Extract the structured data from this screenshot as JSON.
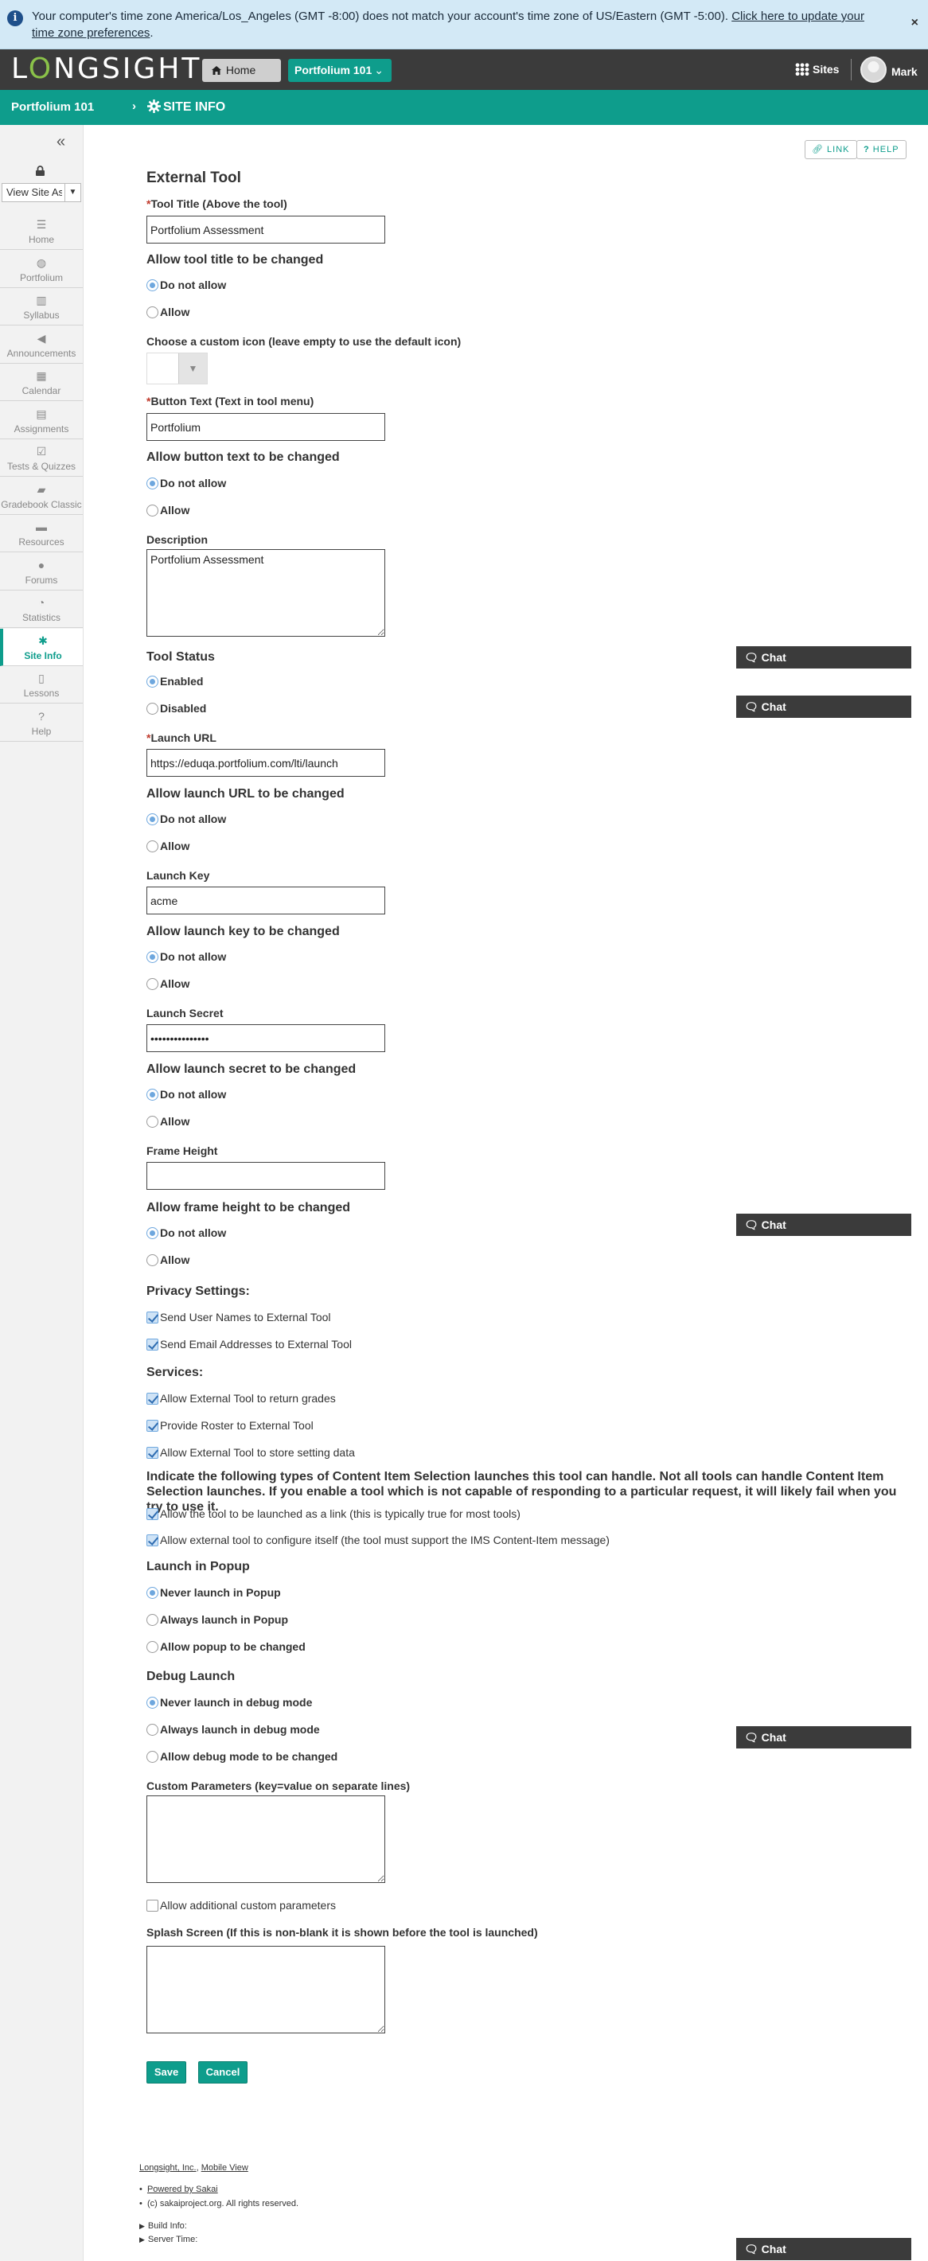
{
  "banner": {
    "message": "Your computer's time zone America/Los_Angeles (GMT -8:00) does not match your account's time zone of US/Eastern (GMT -5:00). ",
    "link": "Click here to update your time zone preferences",
    "period": ".",
    "close": "×"
  },
  "header": {
    "logo_pre": "L",
    "logo_leaf": "O",
    "logo_post": "NGSIGHT",
    "home": "Home",
    "site": "Portfolium 101",
    "sites": "Sites",
    "user": "Mark"
  },
  "breadcrumb": {
    "site": "Portfolium 101",
    "sep": "›",
    "page": "SITE INFO"
  },
  "sidebar": {
    "view_as": "View Site As",
    "items": [
      {
        "label": "Home",
        "icon": "home-icon",
        "glyph": "☰"
      },
      {
        "label": "Portfolium",
        "icon": "globe-icon",
        "glyph": "◍"
      },
      {
        "label": "Syllabus",
        "icon": "map-icon",
        "glyph": "▥"
      },
      {
        "label": "Announcements",
        "icon": "bullhorn-icon",
        "glyph": "◀"
      },
      {
        "label": "Calendar",
        "icon": "calendar-icon",
        "glyph": "▦"
      },
      {
        "label": "Assignments",
        "icon": "file-icon",
        "glyph": "▤"
      },
      {
        "label": "Tests & Quizzes",
        "icon": "checkbox-icon",
        "glyph": "☑"
      },
      {
        "label": "Gradebook Classic",
        "icon": "book-icon",
        "glyph": "▰"
      },
      {
        "label": "Resources",
        "icon": "folder-icon",
        "glyph": "▬"
      },
      {
        "label": "Forums",
        "icon": "comments-icon",
        "glyph": "●"
      },
      {
        "label": "Statistics",
        "icon": "pie-chart-icon",
        "glyph": "◔"
      },
      {
        "label": "Site Info",
        "icon": "gear-icon",
        "glyph": "✱"
      },
      {
        "label": "Lessons",
        "icon": "open-book-icon",
        "glyph": "▯"
      },
      {
        "label": "Help",
        "icon": "question-icon",
        "glyph": "?"
      }
    ]
  },
  "links": {
    "link": "LINK",
    "help": "HELP"
  },
  "form": {
    "title": "External Tool",
    "tool_title_label": "Tool Title (Above the tool)",
    "tool_title_value": "Portfolium Assessment",
    "allow_title_heading": "Allow tool title to be changed",
    "do_not_allow": "Do not allow",
    "allow": "Allow",
    "custom_icon_label": "Choose a custom icon (leave empty to use the default icon)",
    "button_text_label": "Button Text (Text in tool menu)",
    "button_text_value": "Portfolium",
    "allow_button_heading": "Allow button text to be changed",
    "description_label": "Description",
    "description_value": "Portfolium Assessment",
    "status_heading": "Tool Status",
    "enabled": "Enabled",
    "disabled": "Disabled",
    "launch_url_label": "Launch URL",
    "launch_url_value": "https://eduqa.portfolium.com/lti/launch",
    "allow_url_heading": "Allow launch URL to be changed",
    "launch_key_label": "Launch Key",
    "launch_key_value": "acme",
    "allow_key_heading": "Allow launch key to be changed",
    "launch_secret_label": "Launch Secret",
    "launch_secret_value": "•••••••••••••••",
    "allow_secret_heading": "Allow launch secret to be changed",
    "frame_height_label": "Frame Height",
    "frame_height_value": "",
    "allow_frame_heading": "Allow frame height to be changed",
    "privacy_heading": "Privacy Settings:",
    "send_names": "Send User Names to External Tool",
    "send_emails": "Send Email Addresses to External Tool",
    "services_heading": "Services:",
    "return_grades": "Allow External Tool to return grades",
    "provide_roster": "Provide Roster to External Tool",
    "store_settings": "Allow External Tool to store setting data",
    "content_item_heading": "Indicate the following types of Content Item Selection launches this tool can handle. Not all tools can handle Content Item Selection launches. If you enable a tool which is not capable of responding to a particular request, it will likely fail when you try to use it.",
    "launch_as_link": "Allow the tool to be launched as a link (this is typically true for most tools)",
    "configure_itself": "Allow external tool to configure itself (the tool must support the IMS Content-Item message)",
    "popup_heading": "Launch in Popup",
    "never_popup": "Never launch in Popup",
    "always_popup": "Always launch in Popup",
    "allow_popup_change": "Allow popup to be changed",
    "debug_heading": "Debug Launch",
    "never_debug": "Never launch in debug mode",
    "always_debug": "Always launch in debug mode",
    "allow_debug_change": "Allow debug mode to be changed",
    "custom_params_label": "Custom Parameters (key=value on separate lines)",
    "allow_additional_params": "Allow additional custom parameters",
    "splash_label": "Splash Screen (If this is non-blank it is shown before the tool is launched)",
    "save": "Save",
    "cancel": "Cancel"
  },
  "chat": {
    "label": "Chat"
  },
  "footer": {
    "company": "Longsight, Inc.",
    "mobile": "Mobile View",
    "powered": "Powered by Sakai",
    "copyright": "(c) sakaiproject.org. All rights reserved.",
    "build": "Build Info:",
    "server_time": "Server Time:"
  },
  "colors": {
    "brand": "#0e9d8c",
    "header": "#3b3b3b",
    "banner": "#d3e9f6"
  }
}
